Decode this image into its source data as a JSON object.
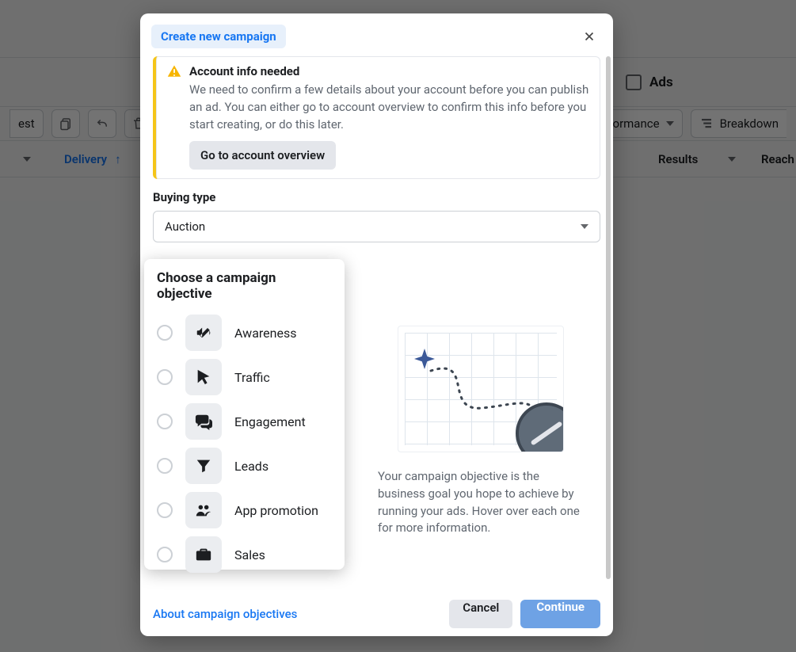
{
  "background": {
    "tab_ads": "Ads",
    "toolbar_left": "est",
    "columns_label": "Columns: Performance",
    "breakdown_label": "Breakdown",
    "header_delivery": "Delivery",
    "header_delivery_arrow": "↑",
    "header_results": "Results",
    "header_reach": "Reach"
  },
  "modal": {
    "breadcrumb": "Create new campaign",
    "alert": {
      "title": "Account info needed",
      "body": "We need to confirm a few details about your account before you can publish an ad. You can either go to account overview to confirm this info before you start creating, or do this later.",
      "button": "Go to account overview"
    },
    "buying_type_label": "Buying type",
    "buying_type_value": "Auction",
    "objective_title": "Choose a campaign objective",
    "objectives": [
      {
        "key": "awareness",
        "label": "Awareness",
        "icon": "megaphone-icon"
      },
      {
        "key": "traffic",
        "label": "Traffic",
        "icon": "cursor-icon"
      },
      {
        "key": "engagement",
        "label": "Engagement",
        "icon": "chat-icon"
      },
      {
        "key": "leads",
        "label": "Leads",
        "icon": "funnel-icon"
      },
      {
        "key": "apppromotion",
        "label": "App promotion",
        "icon": "people-icon"
      },
      {
        "key": "sales",
        "label": "Sales",
        "icon": "briefcase-icon"
      }
    ],
    "right_text": "Your campaign objective is the business goal you hope to achieve by running your ads. Hover over each one for more information.",
    "about_link": "About campaign objectives",
    "cancel": "Cancel",
    "continue": "Continue"
  }
}
